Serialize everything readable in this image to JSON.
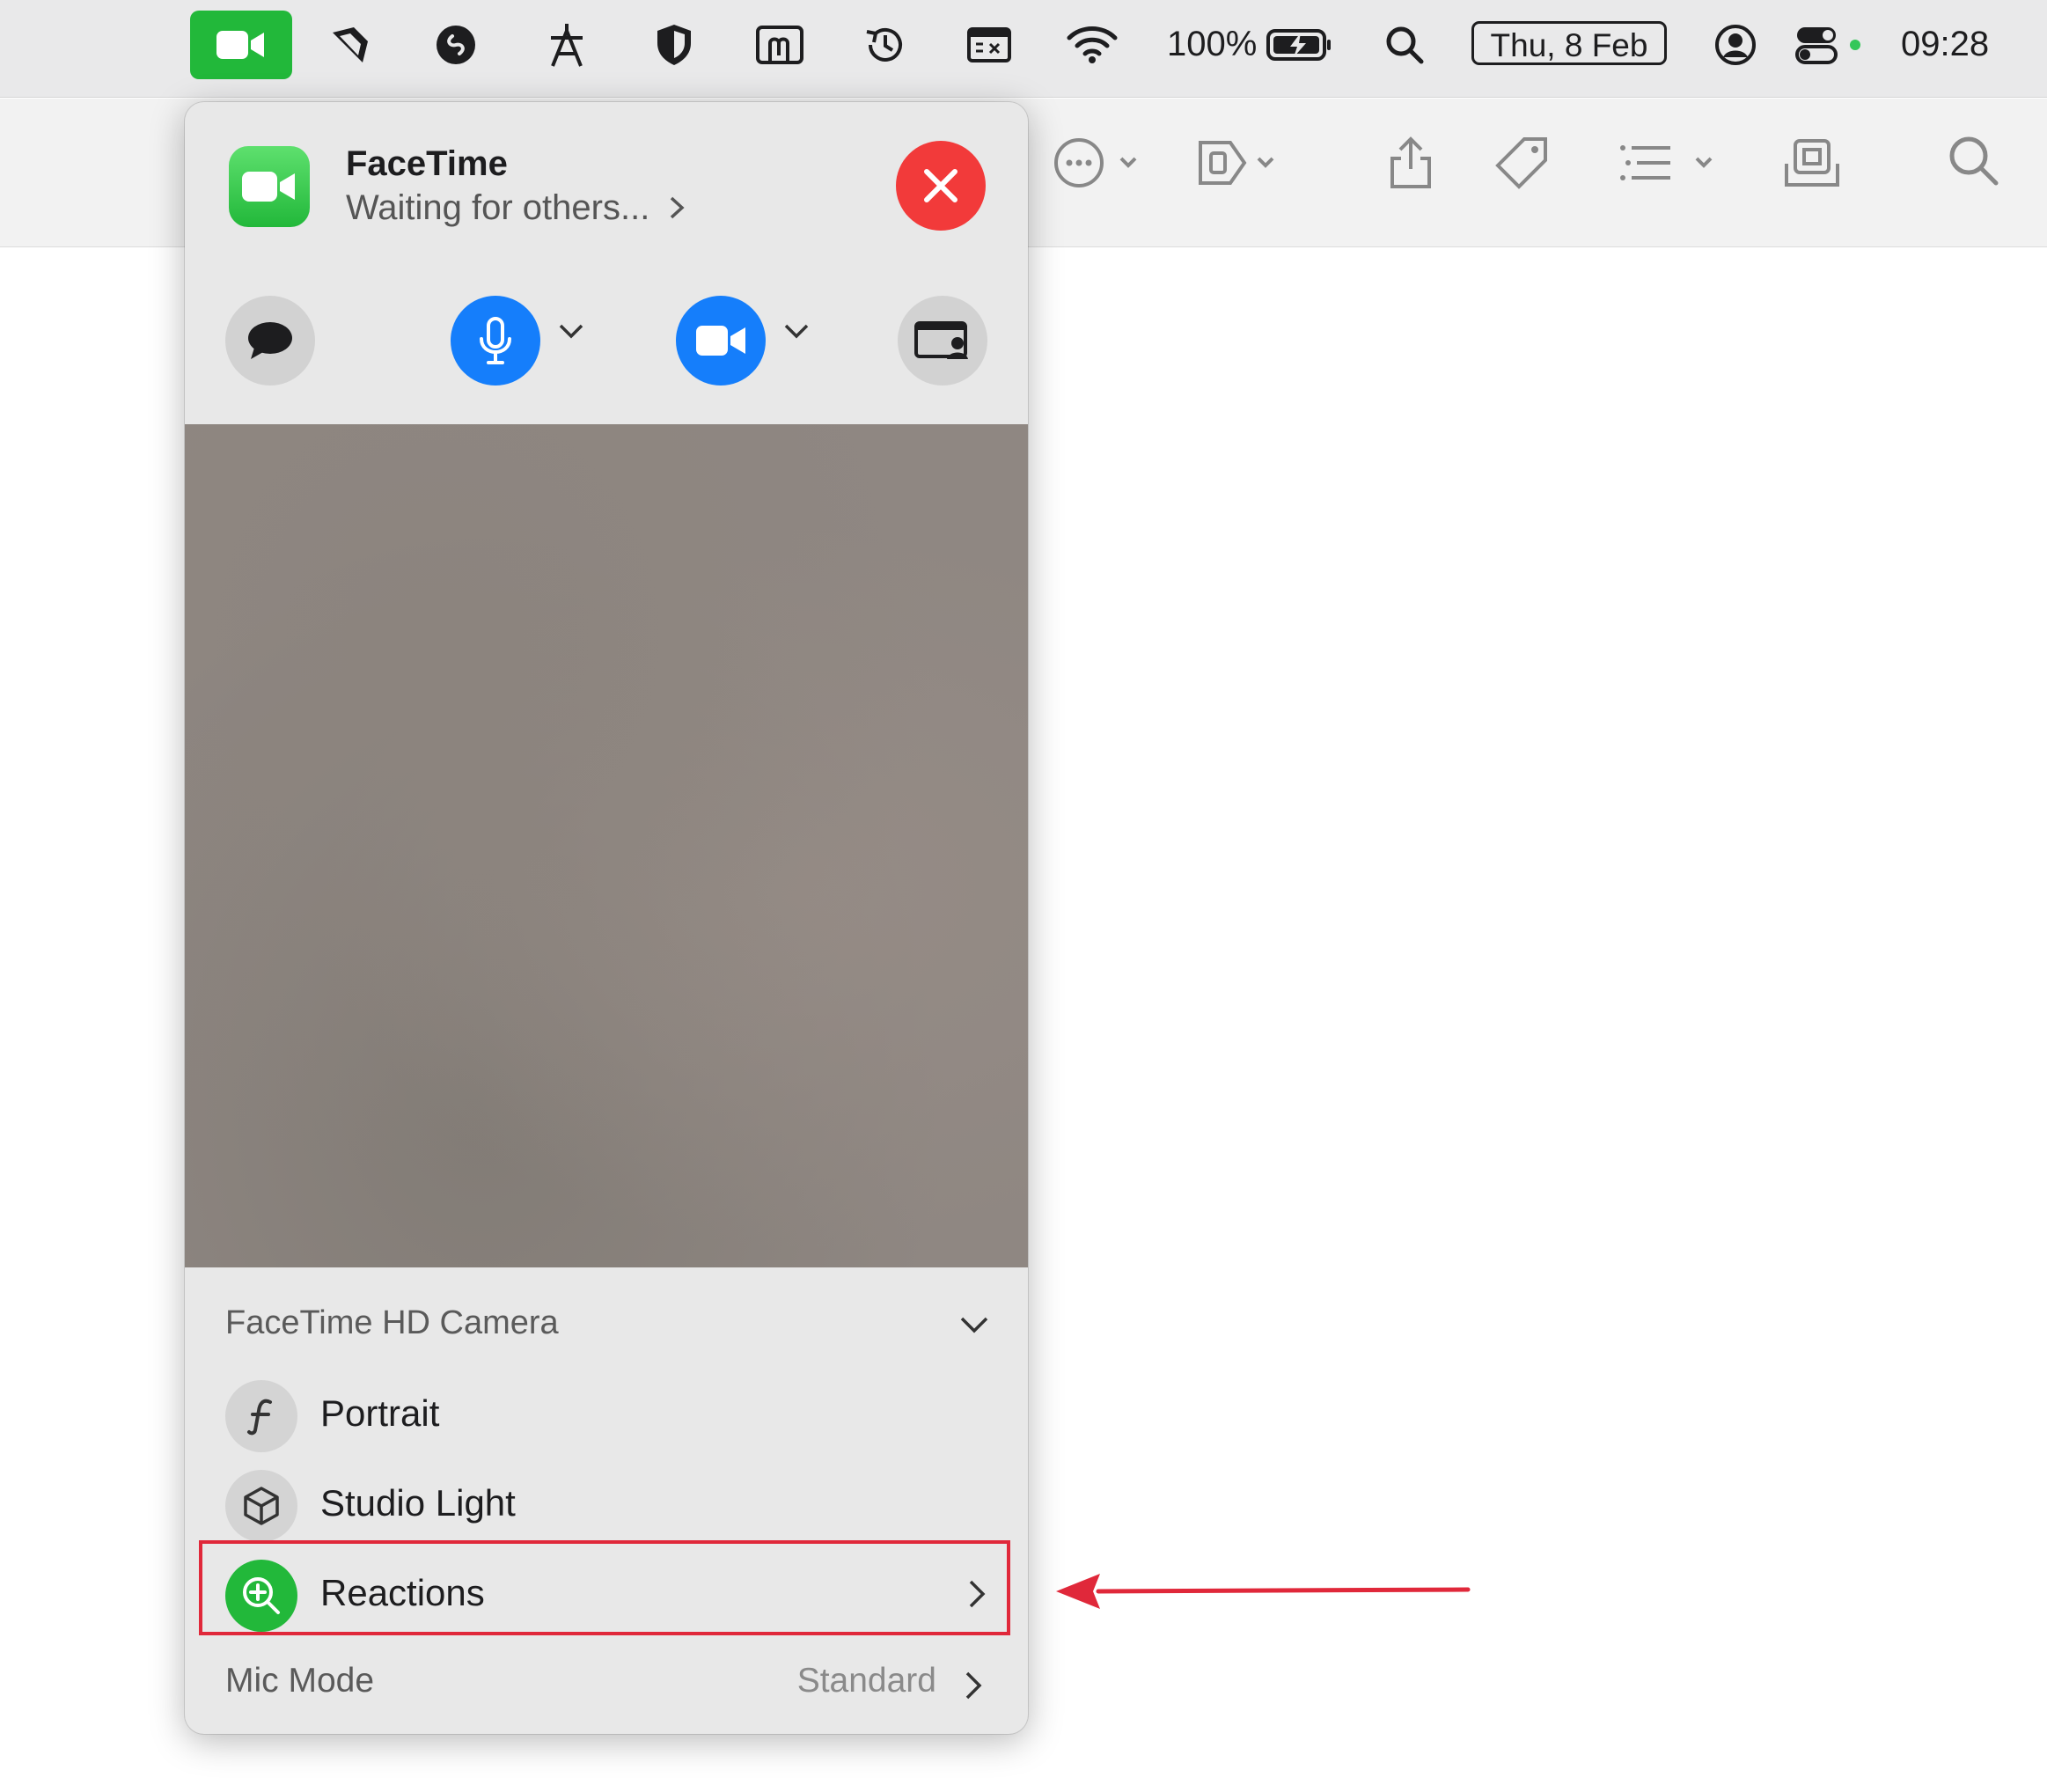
{
  "menubar": {
    "battery": "100%",
    "date": "Thu, 8 Feb",
    "time": "09:28",
    "icons": [
      "facetime-icon",
      "cursor-tool-icon",
      "shazam-icon",
      "text-tool-icon",
      "shield-icon",
      "hand-icon",
      "history-icon",
      "keyboard-icon",
      "wifi-icon",
      "battery-icon",
      "search-icon",
      "user-account-icon",
      "control-center-icon"
    ]
  },
  "toolbar": {
    "icons": [
      "more-icon",
      "tag-shape-icon",
      "share-icon",
      "tag-icon",
      "list-icon",
      "archive-icon",
      "search-icon"
    ]
  },
  "panel": {
    "app_name": "FaceTime",
    "status": "Waiting for others...",
    "camera_label": "FaceTime HD Camera",
    "effects": [
      {
        "label": "Portrait"
      },
      {
        "label": "Studio Light"
      },
      {
        "label": "Reactions"
      }
    ],
    "mic_mode_label": "Mic Mode",
    "mic_mode_value": "Standard"
  },
  "colors": {
    "facetime_green": "#22b83a",
    "close_red": "#f23a3a",
    "control_blue": "#157efb",
    "highlight_red": "#e0283a"
  }
}
